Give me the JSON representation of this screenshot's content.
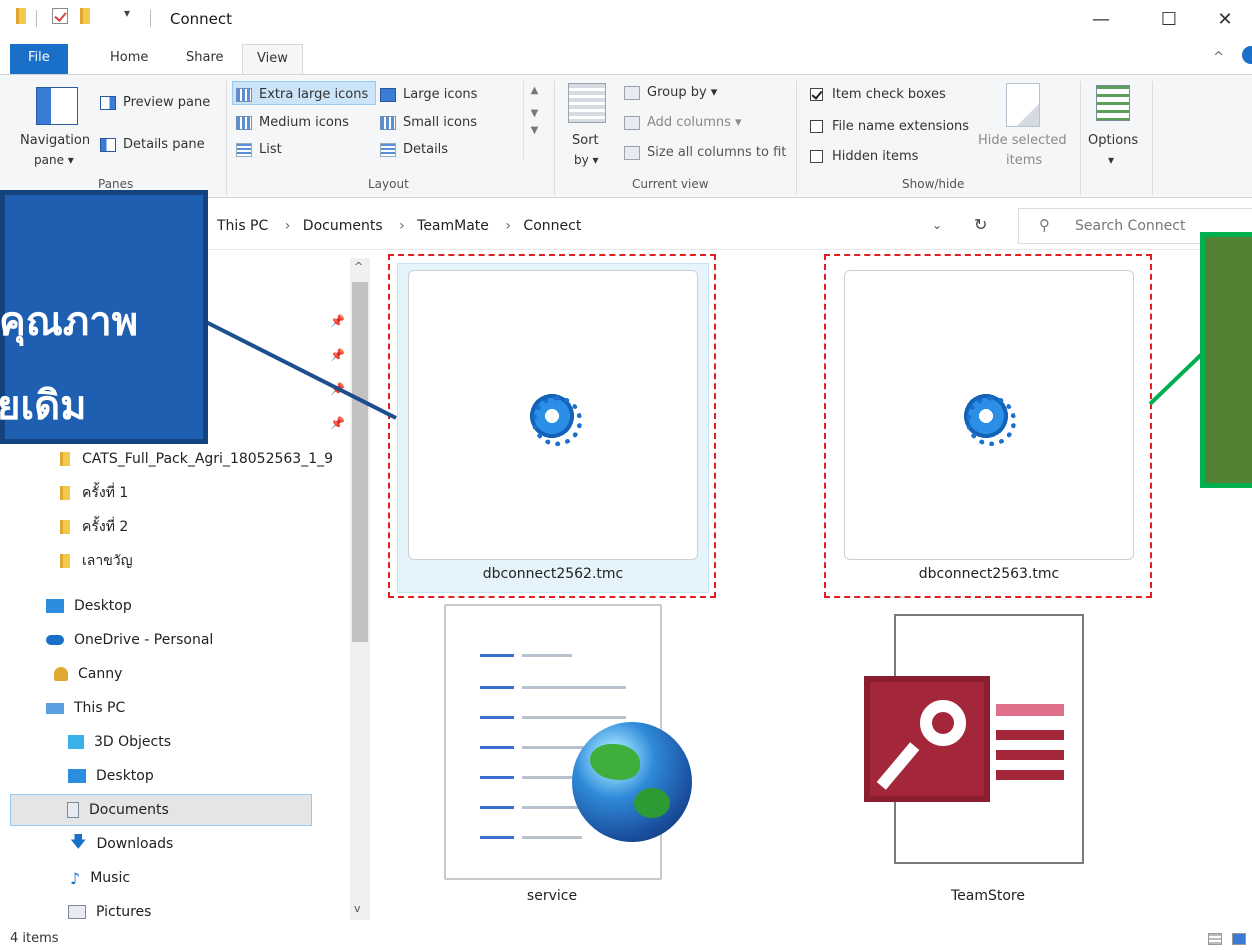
{
  "window": {
    "title": "Connect",
    "minimize": "—",
    "maximize": "☐",
    "close": "✕"
  },
  "tabs": {
    "file": "File",
    "home": "Home",
    "share": "Share",
    "view": "View"
  },
  "ribbon": {
    "panes": {
      "label": "Panes",
      "navigation": "Navigation",
      "navigation2": "pane ▾",
      "preview": "Preview pane",
      "details": "Details pane"
    },
    "layout": {
      "label": "Layout",
      "extra_large": "Extra large icons",
      "large": "Large icons",
      "medium": "Medium icons",
      "small": "Small icons",
      "list": "List",
      "details": "Details"
    },
    "current_view": {
      "label": "Current view",
      "sort": "Sort",
      "sort2": "by ▾",
      "group_by": "Group by ▾",
      "add_columns": "Add columns ▾",
      "size_all": "Size all columns to fit"
    },
    "show_hide": {
      "label": "Show/hide",
      "item_check": "Item check boxes",
      "file_ext": "File name extensions",
      "hidden": "Hidden items",
      "hide_selected": "Hide selected",
      "hide_selected2": "items"
    },
    "options": "Options",
    "options2": "▾"
  },
  "address": {
    "crumbs": [
      "This PC",
      "Documents",
      "TeamMate",
      "Connect"
    ],
    "sep": "›",
    "search_placeholder": "Search Connect"
  },
  "nav": {
    "items": [
      "CATS_Full_Pack_Agri_18052563_1_9",
      "ครั้งที่ 1",
      "ครั้งที่ 2",
      "เลาขวัญ",
      "Desktop",
      "OneDrive - Personal",
      "Canny",
      "This PC",
      "3D Objects",
      "Desktop",
      "Documents",
      "Downloads",
      "Music",
      "Pictures"
    ]
  },
  "files": [
    {
      "name": "dbconnect2562.tmc"
    },
    {
      "name": "dbconnect2563.tmc"
    },
    {
      "name": "service"
    },
    {
      "name": "TeamStore"
    }
  ],
  "status": {
    "count": "4 items"
  },
  "callout": {
    "line1": "คุณภาพ",
    "line2": "ยเดิม"
  },
  "colors": {
    "accent": "#1a6fc9",
    "callout_blue": "#1f5fb2",
    "callout_green": "#548235",
    "highlight": "#e02020"
  }
}
